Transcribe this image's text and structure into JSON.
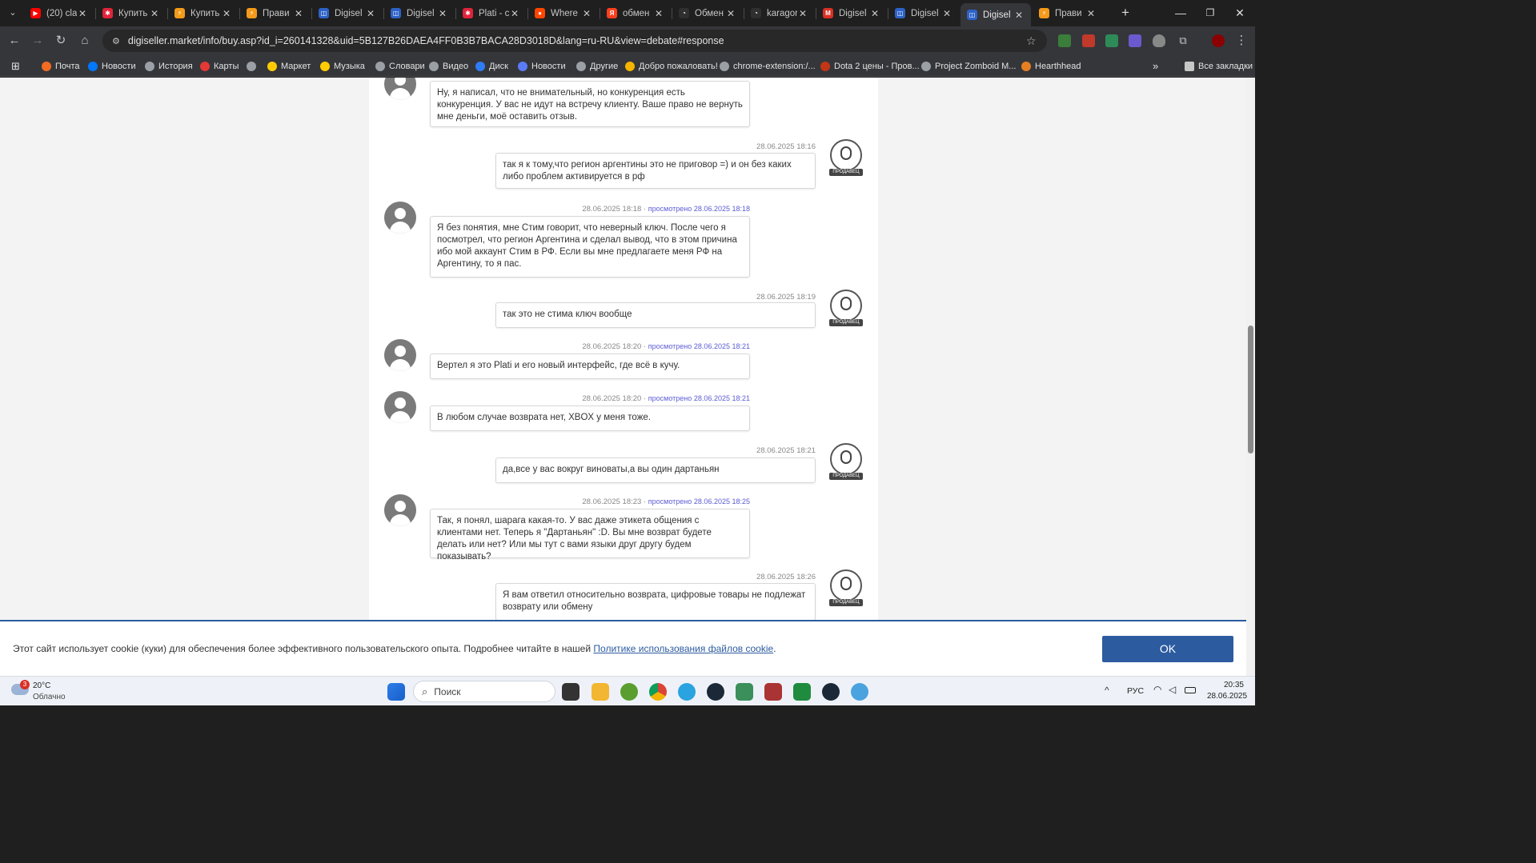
{
  "tabs": [
    {
      "title": "(20) cla",
      "color": "#ff0000",
      "glyph": "▶"
    },
    {
      "title": "Купить",
      "color": "#e0243a",
      "glyph": "✱"
    },
    {
      "title": "Купить",
      "color": "#f39a1a",
      "glyph": "⚡"
    },
    {
      "title": "Прави",
      "color": "#f39a1a",
      "glyph": "⚡"
    },
    {
      "title": "Digisel",
      "color": "#2d62c7",
      "glyph": "◫"
    },
    {
      "title": "Digisel",
      "color": "#2d62c7",
      "glyph": "◫"
    },
    {
      "title": "Plati - c",
      "color": "#e0243a",
      "glyph": "✱"
    },
    {
      "title": "Where",
      "color": "#ff4500",
      "glyph": "●"
    },
    {
      "title": "обмен",
      "color": "#fc3f1d",
      "glyph": "Я"
    },
    {
      "title": "Обмен",
      "color": "#2f2f2f",
      "glyph": "◔"
    },
    {
      "title": "karagor",
      "color": "#2f2f2f",
      "glyph": "◔"
    },
    {
      "title": "Digisel",
      "color": "#d93025",
      "glyph": "M"
    },
    {
      "title": "Digisel",
      "color": "#2d62c7",
      "glyph": "◫"
    },
    {
      "title": "Digisel",
      "color": "#2d62c7",
      "glyph": "◫",
      "active": true
    },
    {
      "title": "Прави",
      "color": "#f39a1a",
      "glyph": "⚡"
    }
  ],
  "address": {
    "url": "digiseller.market/info/buy.asp?id_i=260141328&uid=5B127B26DAEA4FF0B3B7BACA28D3018D&lang=ru-RU&view=debate#response"
  },
  "bookmarks": [
    {
      "label": "Почта",
      "color": "#f36c21"
    },
    {
      "label": "Новости",
      "color": "#0077ff"
    },
    {
      "label": "История",
      "color": "#9aa0a6"
    },
    {
      "label": "Карты",
      "color": "#e53935"
    },
    {
      "label": "",
      "color": "#9aa0a6"
    },
    {
      "label": "Маркет",
      "color": "#ffcc00"
    },
    {
      "label": "Музыка",
      "color": "#ffcc00"
    },
    {
      "label": "Словари",
      "color": "#9aa0a6"
    },
    {
      "label": "Видео",
      "color": "#9aa0a6"
    },
    {
      "label": "Диск",
      "color": "#2f7cf6"
    },
    {
      "label": "Новости",
      "color": "#5b7cf6"
    },
    {
      "label": "Другие",
      "color": "#9aa0a6"
    },
    {
      "label": "Добро пожаловать!",
      "color": "#f4b400"
    },
    {
      "label": "chrome-extension:/...",
      "color": "#9aa0a6"
    },
    {
      "label": "Dota 2 цены - Пров...",
      "color": "#c23616"
    },
    {
      "label": "Project Zomboid M...",
      "color": "#9aa0a6"
    },
    {
      "label": "Hearthhead",
      "color": "#e67e22"
    }
  ],
  "bookmarks_all": "Все закладки",
  "seller_tag": "ПРОДАВЕЦ",
  "seen_prefix": "просмотрено",
  "messages": [
    {
      "side": "buyer",
      "time": "",
      "seen": "",
      "text": "Ну, я написал, что не внимательный, но конкуренция есть конкуренция. У вас не идут на встречу клиенту. Ваше право не вернуть мне деньги, моё оставить отзыв."
    },
    {
      "side": "seller",
      "time": "28.06.2025 18:16",
      "seen": "",
      "text": "так я к тому,что регион аргентины это не приговор =) и он без каких либо проблем активируется в рф"
    },
    {
      "side": "buyer",
      "time": "28.06.2025 18:18",
      "seen": "28.06.2025 18:18",
      "text": "Я без понятия, мне Стим говорит, что неверный ключ. После чего я посмотрел, что регион Аргентина и сделал вывод, что в этом причина ибо мой аккаунт Стим в РФ. Если вы мне предлагаете меня РФ на Аргентину, то я пас."
    },
    {
      "side": "seller",
      "time": "28.06.2025 18:19",
      "seen": "",
      "text": "так это не стима ключ вообще"
    },
    {
      "side": "buyer",
      "time": "28.06.2025 18:20",
      "seen": "28.06.2025 18:21",
      "text": "Вертел я это Plati и его новый интерфейс, где всё в кучу."
    },
    {
      "side": "buyer",
      "time": "28.06.2025 18:20",
      "seen": "28.06.2025 18:21",
      "text": "В любом случае возврата нет, XBOX у меня тоже."
    },
    {
      "side": "seller",
      "time": "28.06.2025 18:21",
      "seen": "",
      "text": "да,все у вас вокруг виноваты,а вы один дартаньян"
    },
    {
      "side": "buyer",
      "time": "28.06.2025 18:23",
      "seen": "28.06.2025 18:25",
      "text": "Так, я понял, шарага какая-то. У вас даже этикета общения с клиентами нет. Теперь я \"Дартаньян\" :D. Вы мне возврат будете делать или нет? Или мы тут с вами языки друг другу будем показывать?"
    },
    {
      "side": "seller",
      "time": "28.06.2025 18:26",
      "seen": "",
      "text": "Я вам ответил относительно возврата, цифровые товары не подлежат возврату или обмену"
    }
  ],
  "cookie": {
    "text": "Этот сайт использует cookie (куки) для обеспечения более эффективного пользовательского опыта. Подробнее читайте в нашей",
    "link": "Политике использования файлов cookie",
    "end": ".",
    "ok": "OK"
  },
  "taskbar": {
    "weather_temp": "20°C",
    "weather_desc": "Облачно",
    "weather_badge": "3",
    "search_placeholder": "Поиск",
    "lang": "РУС",
    "time": "20:35",
    "date": "28.06.2025"
  }
}
